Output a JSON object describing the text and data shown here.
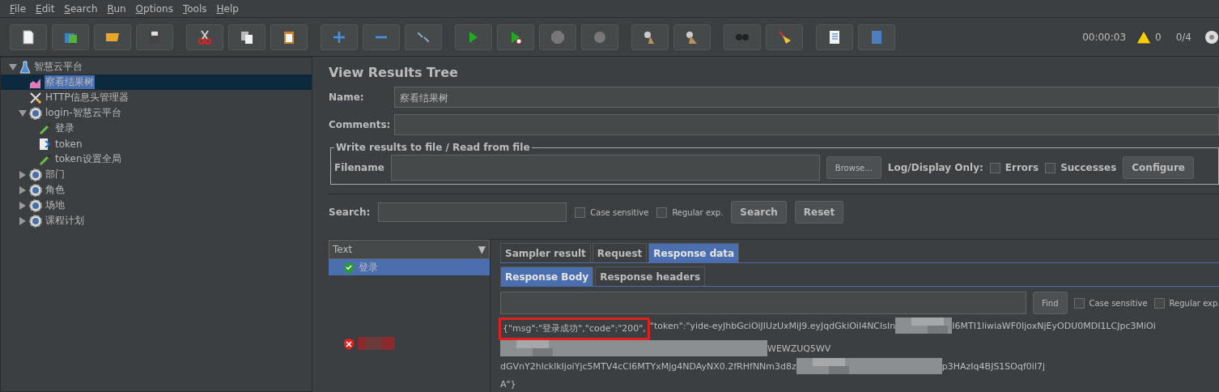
{
  "menu": [
    "File",
    "Edit",
    "Search",
    "Run",
    "Options",
    "Tools",
    "Help"
  ],
  "status": {
    "timer": "00:00:03",
    "warnings": "0",
    "threads": "0/4"
  },
  "tree": [
    {
      "label": "智慧云平台",
      "kind": "plan",
      "expanded": true,
      "selected": false,
      "children": [
        {
          "label": "察看结果树",
          "kind": "listener",
          "selected": true
        },
        {
          "label": "HTTP信息头管理器",
          "kind": "config",
          "selected": false
        },
        {
          "label": "login-智慧云平台",
          "kind": "group",
          "expanded": true,
          "selected": false,
          "children": [
            {
              "label": "登录",
              "kind": "sampler",
              "selected": false
            },
            {
              "label": "token",
              "kind": "extractor",
              "selected": false
            },
            {
              "label": "token设置全局",
              "kind": "sampler",
              "selected": false
            }
          ]
        },
        {
          "label": "部门",
          "kind": "group",
          "expanded": false,
          "selected": false
        },
        {
          "label": "角色",
          "kind": "group",
          "expanded": false,
          "selected": false
        },
        {
          "label": "场地",
          "kind": "group",
          "expanded": false,
          "selected": false
        },
        {
          "label": "课程计划",
          "kind": "group",
          "expanded": false,
          "selected": false
        }
      ]
    }
  ],
  "panel": {
    "title": "View Results Tree",
    "name_label": "Name:",
    "name_value": "察看结果树",
    "comments_label": "Comments:",
    "file_group": "Write results to file / Read from file",
    "filename_label": "Filename",
    "browse": "Browse...",
    "log_label": "Log/Display Only:",
    "log_options": [
      {
        "label": "Errors",
        "checked": false
      },
      {
        "label": "Successes",
        "checked": false
      }
    ],
    "configure": "Configure"
  },
  "search": {
    "label": "Search:",
    "options": [
      {
        "label": "Case sensitive",
        "checked": false
      },
      {
        "label": "Regular exp.",
        "checked": false
      }
    ],
    "search_button": "Search",
    "reset_button": "Reset"
  },
  "results": {
    "renderer": "Text",
    "renderer_arrow": "▼",
    "items": [
      {
        "label": "登录",
        "ok": true,
        "selected": true
      },
      {
        "ok": false,
        "selected": false
      }
    ]
  },
  "tabs": [
    {
      "label": "Sampler result",
      "selected": false
    },
    {
      "label": "Request",
      "selected": false
    },
    {
      "label": "Response data",
      "selected": true
    }
  ],
  "subtabs": [
    {
      "label": "Response Body",
      "selected": true
    },
    {
      "label": "Response headers",
      "selected": false
    }
  ],
  "find": {
    "button": "Find",
    "options": [
      {
        "label": "Case sensitive",
        "checked": false
      },
      {
        "label": "Regular exp.",
        "checked": false
      }
    ]
  },
  "response": {
    "highlight": "{\"msg\":\"登录成功\",\"code\":\"200\",",
    "lines": [
      {
        "text": "\"token\":\"yide-eyJhbGciOiJIUzUxMiJ9.eyJqdGkiOiI4NCIsIn",
        "rest": "I6MTI1liwiaWF0IjoxNjEyODU0MDI1LCJpc3MiOi"
      },
      {
        "rest": "WEWZUQ5WV"
      },
      {
        "text": "dGVnY2hlcklkIjoiYjc5MTV4cCI6MTYxMjg4NDAyNX0.2fRHfNNm3d8z",
        "rest": "p3HAzIq4BJS1SOqf0il7j"
      },
      {
        "text": "A\"}"
      }
    ]
  }
}
